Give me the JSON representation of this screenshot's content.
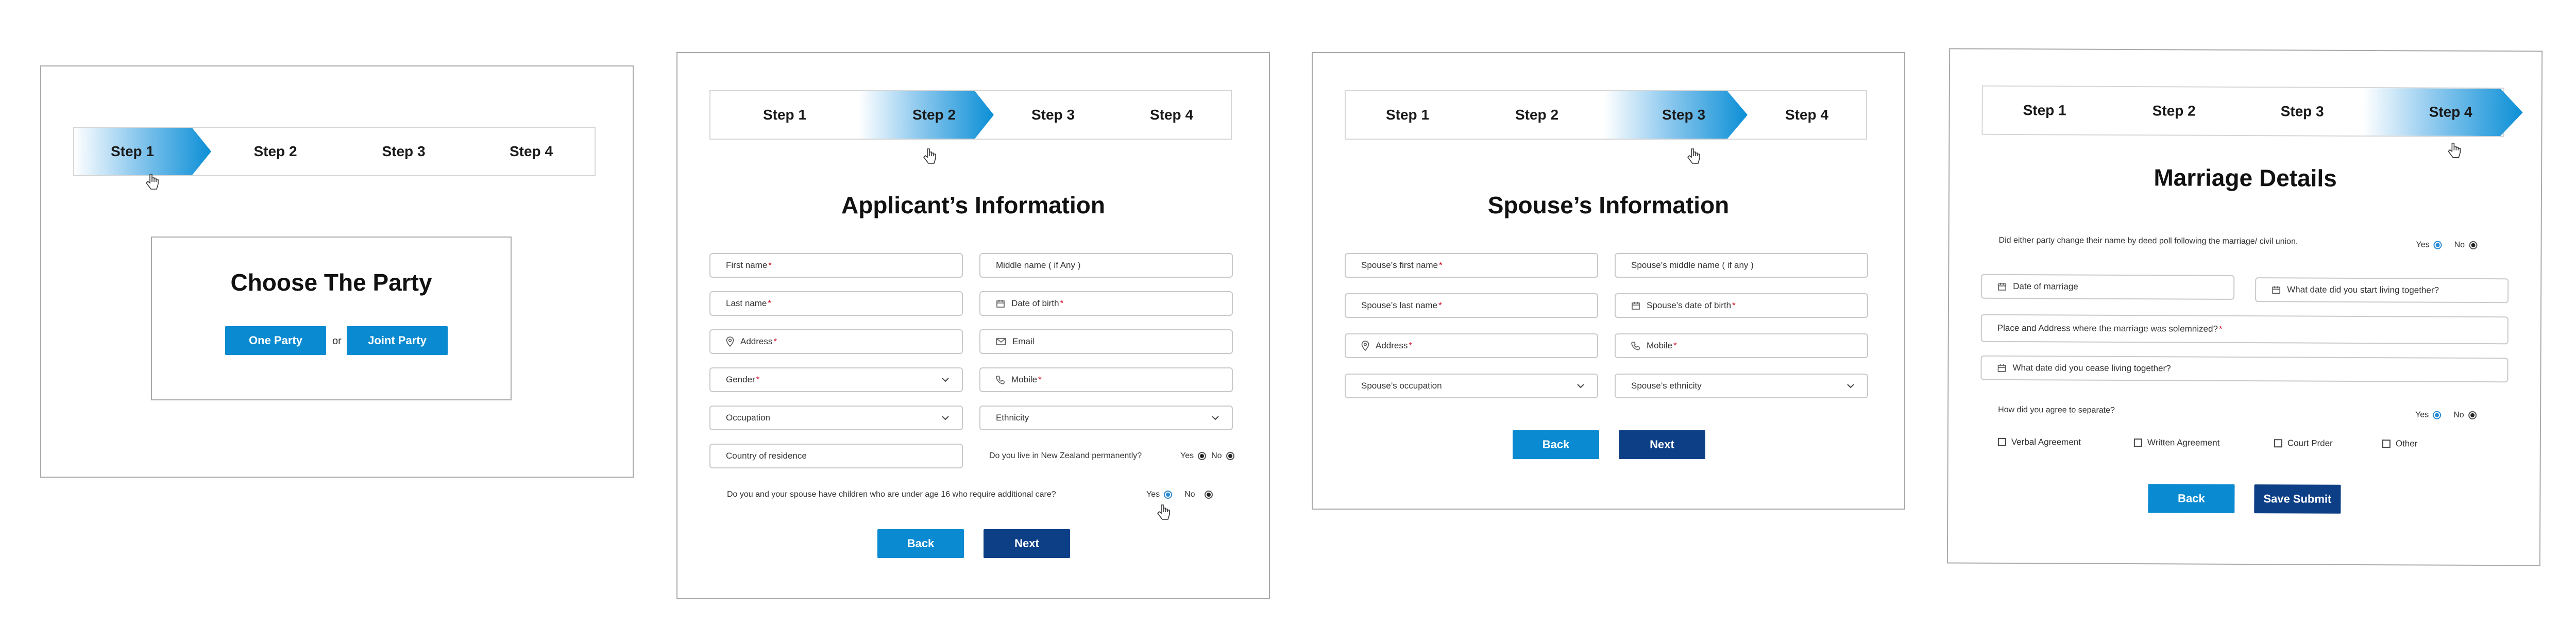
{
  "steps": [
    "Step 1",
    "Step 2",
    "Step 3",
    "Step 4"
  ],
  "panel1": {
    "title": "Choose The Party",
    "one_party": "One Party",
    "or": "or",
    "joint_party": "Joint Party"
  },
  "panel2": {
    "title": "Applicant’s Information",
    "fields": {
      "first_name": "First name",
      "middle_name": "Middle name ( if Any )",
      "last_name": "Last name",
      "dob": "Date of birth",
      "address": "Address",
      "email": "Email",
      "gender": "Gender",
      "mobile": "Mobile",
      "occupation": "Occupation",
      "ethnicity": "Ethnicity",
      "country": "Country of residence"
    },
    "q_nz": "Do you live in New Zealand permanently?",
    "q_children": "Do you and your spouse have children who are under age 16 who require additional care?",
    "yes": "Yes",
    "no": "No",
    "back": "Back",
    "next": "Next"
  },
  "panel3": {
    "title": "Spouse’s Information",
    "fields": {
      "first_name": "Spouse’s first name",
      "middle_name": "Spouse’s middle name ( if any )",
      "last_name": "Spouse’s last name",
      "dob": "Spouse’s date of birth",
      "address": "Address",
      "mobile": "Mobile",
      "occupation": "Spouse’s occupation",
      "ethnicity": "Spouse’s ethnicity"
    },
    "back": "Back",
    "next": "Next"
  },
  "panel4": {
    "title": "Marriage Details",
    "q_name_change": "Did either party change their name by deed poll following the marriage/ civil union.",
    "yes": "Yes",
    "no": "No",
    "fields": {
      "date_marriage": "Date of marriage",
      "start_living": "What date did you start living together?",
      "place_address": "Place and Address where the marriage was solemnized?",
      "cease_living": "What date did you cease living together?"
    },
    "q_separate": "How did you agree to separate?",
    "options": [
      "Verbal Agreement",
      "Written Agreement",
      "Court Prder",
      "Other"
    ],
    "back": "Back",
    "submit": "Save Submit"
  },
  "colors": {
    "accent": "#0a8ad0",
    "primary_dark": "#0d3f86",
    "required": "#d0021b"
  }
}
